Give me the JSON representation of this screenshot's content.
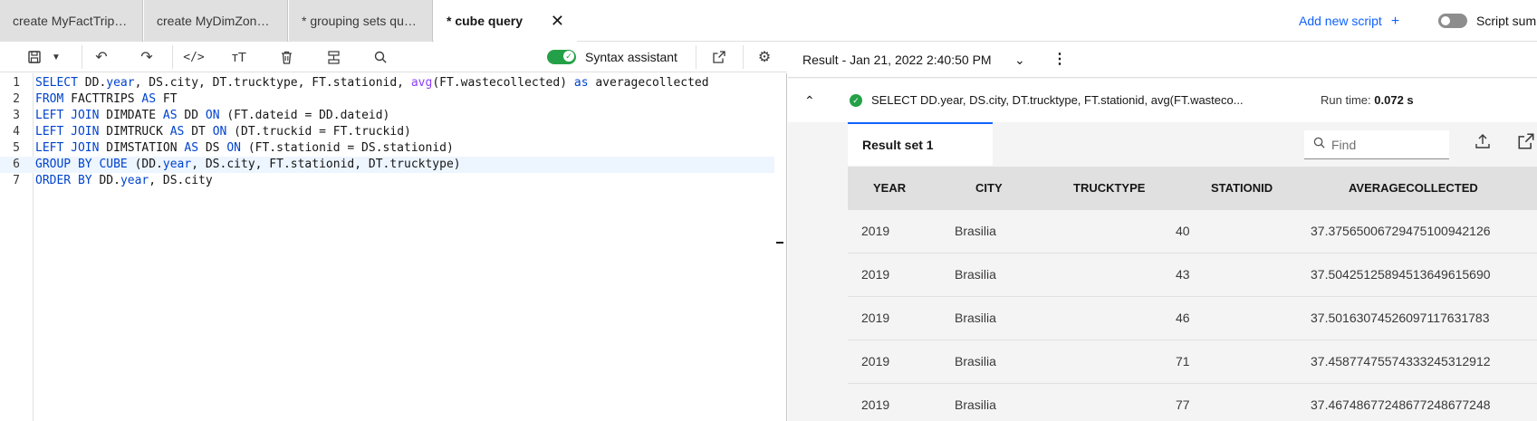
{
  "tabs": [
    {
      "label": "create MyFactTrip…"
    },
    {
      "label": "create MyDimZon…"
    },
    {
      "label": "* grouping sets qu…"
    },
    {
      "label": "* cube query"
    }
  ],
  "header": {
    "add_script_label": "Add new script",
    "script_summary_label": "Script sum"
  },
  "toolbar": {
    "syntax_assistant_label": "Syntax assistant",
    "syntax_assistant_enabled": true
  },
  "editor": {
    "lines": [
      {
        "num": "1",
        "segments": [
          [
            "kw",
            "SELECT"
          ],
          [
            "t",
            " DD."
          ],
          [
            "kw",
            "year"
          ],
          [
            "t",
            ", DS.city, DT.trucktype, FT.stationid, "
          ],
          [
            "fn",
            "avg"
          ],
          [
            "t",
            "(FT.wastecollected) "
          ],
          [
            "kw",
            "as"
          ],
          [
            "t",
            " averagecollected"
          ]
        ]
      },
      {
        "num": "2",
        "segments": [
          [
            "kw",
            "FROM"
          ],
          [
            "t",
            " FACTTRIPS "
          ],
          [
            "kw",
            "AS"
          ],
          [
            "t",
            " FT"
          ]
        ]
      },
      {
        "num": "3",
        "segments": [
          [
            "kw",
            "LEFT JOIN"
          ],
          [
            "t",
            " DIMDATE "
          ],
          [
            "kw",
            "AS"
          ],
          [
            "t",
            " DD "
          ],
          [
            "kw",
            "ON"
          ],
          [
            "t",
            " (FT.dateid = DD.dateid)"
          ]
        ]
      },
      {
        "num": "4",
        "segments": [
          [
            "kw",
            "LEFT JOIN"
          ],
          [
            "t",
            " DIMTRUCK "
          ],
          [
            "kw",
            "AS"
          ],
          [
            "t",
            " DT "
          ],
          [
            "kw",
            "ON"
          ],
          [
            "t",
            " (DT.truckid = FT.truckid)"
          ]
        ]
      },
      {
        "num": "5",
        "segments": [
          [
            "kw",
            "LEFT JOIN"
          ],
          [
            "t",
            " DIMSTATION "
          ],
          [
            "kw",
            "AS"
          ],
          [
            "t",
            " DS "
          ],
          [
            "kw",
            "ON"
          ],
          [
            "t",
            " (FT.stationid = DS.stationid)"
          ]
        ]
      },
      {
        "num": "6",
        "segments": [
          [
            "kw",
            "GROUP BY CUBE"
          ],
          [
            "t",
            " (DD."
          ],
          [
            "kw",
            "year"
          ],
          [
            "t",
            ", DS.city, FT.stationid, DT.trucktype)"
          ]
        ]
      },
      {
        "num": "7",
        "segments": [
          [
            "kw",
            "ORDER BY"
          ],
          [
            "t",
            " DD."
          ],
          [
            "kw",
            "year"
          ],
          [
            "t",
            ", DS.city"
          ]
        ]
      }
    ]
  },
  "results": {
    "title": "Result - Jan 21, 2022 2:40:50 PM",
    "query_summary": "SELECT DD.year, DS.city, DT.trucktype, FT.stationid, avg(FT.wasteco...",
    "run_time_label": "Run time:",
    "run_time_value": "0.072 s",
    "result_set_tab": "Result set 1",
    "find_placeholder": "Find",
    "columns": [
      "YEAR",
      "CITY",
      "TRUCKTYPE",
      "STATIONID",
      "AVERAGECOLLECTED"
    ],
    "rows": [
      [
        "2019",
        "Brasilia",
        "",
        "40",
        "37.37565006729475100942126"
      ],
      [
        "2019",
        "Brasilia",
        "",
        "43",
        "37.50425125894513649615690"
      ],
      [
        "2019",
        "Brasilia",
        "",
        "46",
        "37.50163074526097117631783"
      ],
      [
        "2019",
        "Brasilia",
        "",
        "71",
        "37.45877475574333245312912"
      ],
      [
        "2019",
        "Brasilia",
        "",
        "77",
        "37.46748677248677248677248"
      ]
    ]
  },
  "colors": {
    "accent": "#0f62fe",
    "success": "#24a148",
    "keyword": "#0043ce",
    "function": "#8a3ffc"
  }
}
